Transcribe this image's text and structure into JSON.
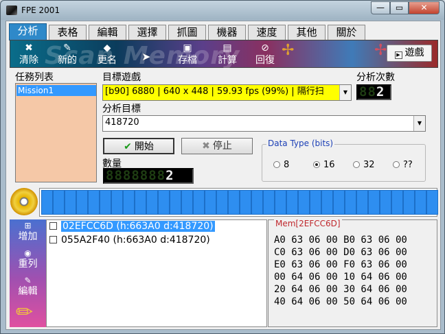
{
  "window": {
    "title": "FPE 2001",
    "min_glyph": "—",
    "max_glyph": "▭",
    "close_glyph": "✕"
  },
  "tabs": [
    {
      "label": "分析",
      "active": true
    },
    {
      "label": "表格"
    },
    {
      "label": "編輯"
    },
    {
      "label": "選擇"
    },
    {
      "label": "抓圖"
    },
    {
      "label": "機器"
    },
    {
      "label": "速度"
    },
    {
      "label": "其他"
    },
    {
      "label": "關於"
    }
  ],
  "toolbar": {
    "watermark": "Scan Memory",
    "buttons": [
      {
        "label": "清除",
        "icon": "clear-icon"
      },
      {
        "label": "新的",
        "icon": "new-icon"
      },
      {
        "label": "更名",
        "icon": "rename-icon"
      },
      {
        "label": "存檔",
        "icon": "save-icon"
      },
      {
        "label": "計算",
        "icon": "calculator-icon"
      },
      {
        "label": "回復",
        "icon": "restore-icon"
      }
    ],
    "game_button": "遊戲"
  },
  "labels": {
    "mission_list": "任務列表",
    "target_game": "目標遊戲",
    "analysis_count": "分析次數",
    "analysis_target": "分析目標",
    "quantity": "數量"
  },
  "missions": [
    "Mission1"
  ],
  "game_select": "[b90] 6880 | 640 x 448 | 59.93 fps (99%) | 隔行扫",
  "target_value": "418720",
  "analysis_count_led": {
    "dim": "88",
    "lit": "2"
  },
  "quantity_led": {
    "dim": "8888888",
    "lit": "2"
  },
  "buttons": {
    "start": "開始",
    "stop": "停止"
  },
  "data_type": {
    "legend": "Data Type (bits)",
    "options": [
      "8",
      "16",
      "32",
      "??"
    ],
    "selected": "16"
  },
  "progress_segments": 34,
  "side_toolbar": [
    {
      "label": "增加",
      "icon": "add-icon"
    },
    {
      "label": "重列",
      "icon": "relist-icon"
    },
    {
      "label": "編輯",
      "icon": "edit-icon"
    }
  ],
  "results": [
    {
      "text": "02EFCC6D (h:663A0 d:418720)",
      "selected": true
    },
    {
      "text": "055A2F40 (h:663A0 d:418720)",
      "selected": false
    }
  ],
  "memory": {
    "title": "Mem[2EFCC6D]",
    "rows": [
      "A0 63 06 00 B0 63 06 00",
      "C0 63 06 00 D0 63 06 00",
      "E0 63 06 00 F0 63 06 00",
      "00 64 06 00 10 64 06 00",
      "20 64 06 00 30 64 06 00",
      "40 64 06 00 50 64 06 00"
    ]
  },
  "colors": {
    "accent": "#2f89c9",
    "game_combo_bg": "#ffff00",
    "mission_bg": "#f5c8a7",
    "progress_fill": "#2e8ef0"
  }
}
